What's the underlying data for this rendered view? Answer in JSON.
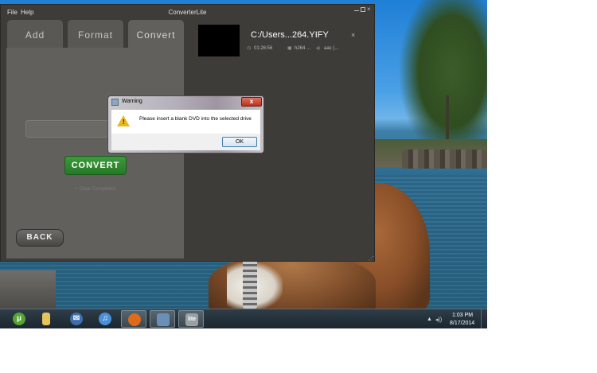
{
  "app": {
    "menu": [
      "File",
      "Help"
    ],
    "title": "ConverterLite",
    "tabs": [
      {
        "label": "Add"
      },
      {
        "label": "Format"
      },
      {
        "label": "Convert"
      }
    ],
    "convert_button": "CONVERT",
    "clear_completed": "Clear Completed",
    "back_button": "BACK",
    "file": {
      "name": "C:/Users...264.YIFY",
      "duration": "01:26:56",
      "video_codec": "h264 ...",
      "audio_codec": "aac (...",
      "close_glyph": "×"
    }
  },
  "dialog": {
    "title": "Warning",
    "message": "Please insert a blank DVD into the selected drive",
    "ok_label": "OK",
    "close_glyph": "x"
  },
  "taskbar": {
    "clock_time": "1:03 PM",
    "clock_date": "8/17/2014",
    "items": [
      "utorrent-icon",
      "folder-icon",
      "thunderbird-icon",
      "itunes-icon",
      "firefox-icon",
      "network-icon",
      "converterlite-icon"
    ],
    "active_item_label": "lite"
  },
  "colors": {
    "convert_button": "#2e8a2e",
    "app_background": "#3e3c39",
    "panel": "#62605c"
  }
}
